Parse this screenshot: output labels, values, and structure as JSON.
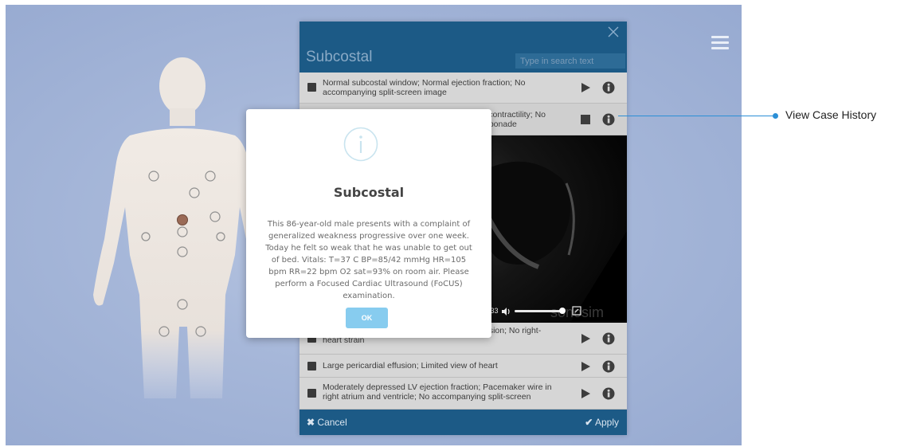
{
  "panel": {
    "title": "Subcostal",
    "search_placeholder": "Type in search text",
    "cases": [
      {
        "text": "Normal subcostal window; Normal ejection fraction; No accompanying split-screen image",
        "action": "play"
      },
      {
        "text": "l contractility; No\nnponade",
        "action": "stop"
      },
      {
        "text": "usion; No right-\nheart strain",
        "action": "play"
      },
      {
        "text": "Large pericardial effusion; Limited view of heart",
        "action": "play"
      },
      {
        "text": "Moderately depressed LV ejection fraction; Pacemaker wire in right atrium and ventricle; No accompanying split-screen",
        "action": "play"
      }
    ],
    "video": {
      "time": "0:33",
      "watermark": "sonosim"
    },
    "cancel_label": "Cancel",
    "apply_label": "Apply"
  },
  "modal": {
    "title": "Subcostal",
    "body": "This 86-year-old male presents with a complaint of generalized weakness progressive over one week. Today he felt so weak that he was unable to get out of bed. Vitals: T=37 C BP=85/42 mmHg HR=105 bpm RR=22 bpm O2 sat=93% on room air. Please perform a Focused Cardiac Ultrasound (FoCUS) examination.",
    "ok_label": "OK",
    "icon": "info-circle-icon"
  },
  "callout": {
    "label": "View Case History"
  },
  "colors": {
    "background": "#a6b7d9",
    "panel_header": "#1c5a86",
    "row": "#d6d6d6",
    "ok_button": "#87ccef",
    "callout": "#2b8fd6",
    "hotspot_active": "#9a6a56"
  },
  "icons": [
    "hamburger-menu-icon",
    "close-icon",
    "checkbox-icon",
    "play-icon",
    "stop-icon",
    "info-icon",
    "volume-icon",
    "fullscreen-icon",
    "cancel-x-icon",
    "checkmark-icon"
  ]
}
